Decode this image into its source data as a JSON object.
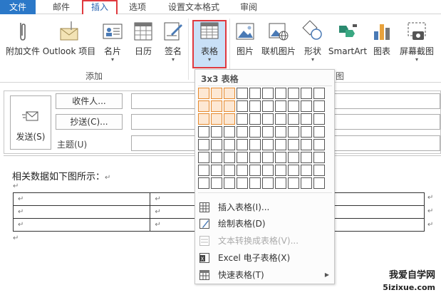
{
  "menubar": {
    "tabs": [
      "文件",
      "邮件",
      "插入",
      "选项",
      "设置文本格式",
      "审阅"
    ],
    "active": "插入"
  },
  "ribbon": {
    "buttons": [
      {
        "label": "附加文件",
        "icon": "paperclip-icon"
      },
      {
        "label": "Outlook 项目",
        "icon": "envelope-attach-icon"
      },
      {
        "label": "名片",
        "icon": "business-card-icon"
      },
      {
        "label": "日历",
        "icon": "calendar-icon"
      },
      {
        "label": "签名",
        "icon": "signature-icon"
      },
      {
        "label": "表格",
        "icon": "table-icon"
      },
      {
        "label": "图片",
        "icon": "picture-icon"
      },
      {
        "label": "联机图片",
        "icon": "online-picture-icon"
      },
      {
        "label": "形状",
        "icon": "shapes-icon"
      },
      {
        "label": "SmartArt",
        "icon": "smartart-icon"
      },
      {
        "label": "图表",
        "icon": "chart-icon"
      },
      {
        "label": "屏幕截图",
        "icon": "screenshot-icon"
      }
    ],
    "group_add": "添加",
    "group_illustrations": "图"
  },
  "header": {
    "send": "发送(S)",
    "to": "收件人...",
    "cc": "抄送(C)...",
    "subject": "主题(U)"
  },
  "body": {
    "text": "相关数据如下图所示：",
    "para_mark": "↵"
  },
  "table_menu": {
    "title": "3x3 表格",
    "grid_cols": 10,
    "grid_rows": 8,
    "selected_cols": 3,
    "selected_rows": 3,
    "items": [
      {
        "label": "插入表格(I)...",
        "enabled": true,
        "icon": "insert-table-icon"
      },
      {
        "label": "绘制表格(D)",
        "enabled": true,
        "icon": "draw-table-icon"
      },
      {
        "label": "文本转换成表格(V)...",
        "enabled": false,
        "icon": "convert-text-table-icon"
      },
      {
        "label": "Excel 电子表格(X)",
        "enabled": true,
        "icon": "excel-icon"
      },
      {
        "label": "快速表格(T)",
        "enabled": true,
        "icon": "quick-table-icon"
      }
    ]
  },
  "watermark": {
    "line1": "我爱自学网",
    "line2": "5izixue.com"
  },
  "colors": {
    "file_tab": "#2b78c8",
    "highlight_red": "#e0393e",
    "grid_selected": "#e68a2e"
  }
}
